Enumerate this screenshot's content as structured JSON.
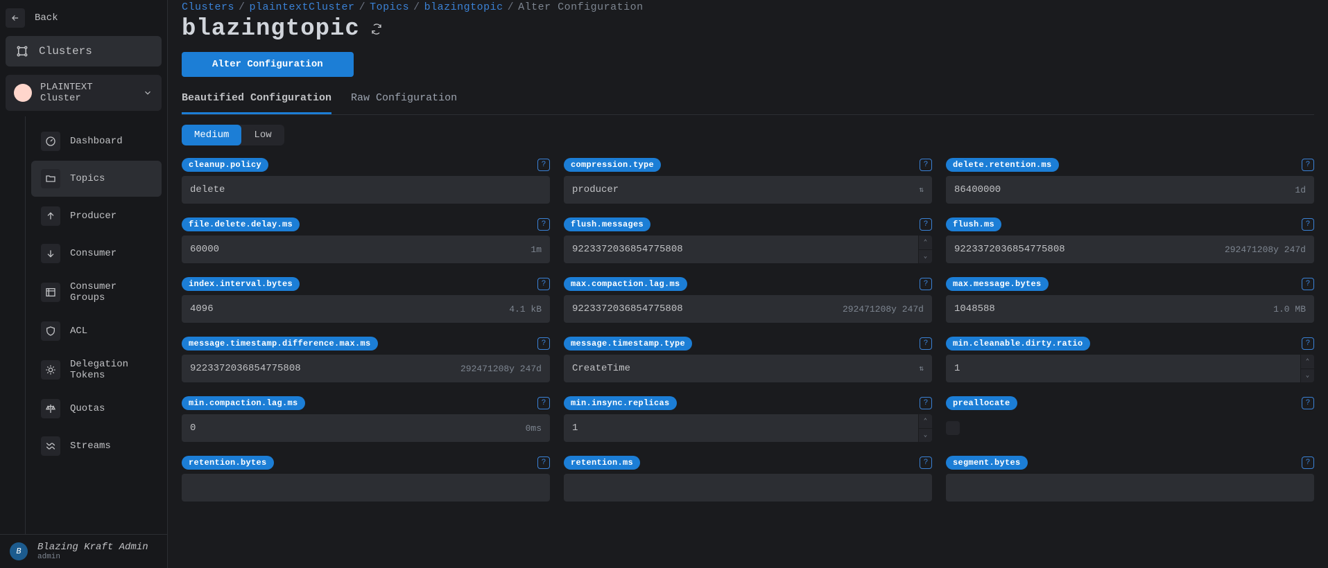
{
  "sidebar": {
    "back": "Back",
    "clusters_label": "Clusters",
    "cluster_selected": "PLAINTEXT Cluster",
    "nav": [
      {
        "label": "Dashboard",
        "icon": "gauge"
      },
      {
        "label": "Topics",
        "icon": "folder",
        "active": true
      },
      {
        "label": "Producer",
        "icon": "up"
      },
      {
        "label": "Consumer",
        "icon": "down"
      },
      {
        "label": "Consumer Groups",
        "icon": "groups"
      },
      {
        "label": "ACL",
        "icon": "shield"
      },
      {
        "label": "Delegation Tokens",
        "icon": "token"
      },
      {
        "label": "Quotas",
        "icon": "scale"
      },
      {
        "label": "Streams",
        "icon": "stream"
      }
    ]
  },
  "user": {
    "avatar": "B",
    "name": "Blazing Kraft Admin",
    "role": "admin"
  },
  "breadcrumbs": [
    {
      "label": "Clusters",
      "link": true
    },
    {
      "label": "plaintextCluster",
      "link": true
    },
    {
      "label": "Topics",
      "link": true
    },
    {
      "label": "blazingtopic",
      "link": true
    },
    {
      "label": "Alter Configuration",
      "link": false
    }
  ],
  "title": "blazingtopic",
  "alter_btn": "Alter Configuration",
  "tabs": [
    {
      "label": "Beautified Configuration",
      "active": true
    },
    {
      "label": "Raw Configuration",
      "active": false
    }
  ],
  "segment": [
    {
      "label": "Medium",
      "on": true
    },
    {
      "label": "Low",
      "on": false
    }
  ],
  "fields": [
    {
      "key": "cleanup.policy",
      "value": "delete",
      "type": "text"
    },
    {
      "key": "compression.type",
      "value": "producer",
      "type": "select"
    },
    {
      "key": "delete.retention.ms",
      "value": "86400000",
      "suffix": "1d",
      "type": "text"
    },
    {
      "key": "file.delete.delay.ms",
      "value": "60000",
      "suffix": "1m",
      "type": "text"
    },
    {
      "key": "flush.messages",
      "value": "9223372036854775808",
      "type": "stepper"
    },
    {
      "key": "flush.ms",
      "value": "9223372036854775808",
      "suffix": "292471208y 247d",
      "type": "text"
    },
    {
      "key": "index.interval.bytes",
      "value": "4096",
      "suffix": "4.1 kB",
      "type": "text"
    },
    {
      "key": "max.compaction.lag.ms",
      "value": "9223372036854775808",
      "suffix": "292471208y 247d",
      "type": "text"
    },
    {
      "key": "max.message.bytes",
      "value": "1048588",
      "suffix": "1.0 MB",
      "type": "text"
    },
    {
      "key": "message.timestamp.difference.max.ms",
      "value": "9223372036854775808",
      "suffix": "292471208y 247d",
      "type": "text"
    },
    {
      "key": "message.timestamp.type",
      "value": "CreateTime",
      "type": "select"
    },
    {
      "key": "min.cleanable.dirty.ratio",
      "value": "1",
      "type": "stepper"
    },
    {
      "key": "min.compaction.lag.ms",
      "value": "0",
      "suffix": "0ms",
      "type": "text"
    },
    {
      "key": "min.insync.replicas",
      "value": "1",
      "type": "stepper"
    },
    {
      "key": "preallocate",
      "value": "",
      "type": "checkbox"
    },
    {
      "key": "retention.bytes",
      "value": "",
      "type": "text"
    },
    {
      "key": "retention.ms",
      "value": "",
      "type": "text"
    },
    {
      "key": "segment.bytes",
      "value": "",
      "type": "text"
    }
  ]
}
